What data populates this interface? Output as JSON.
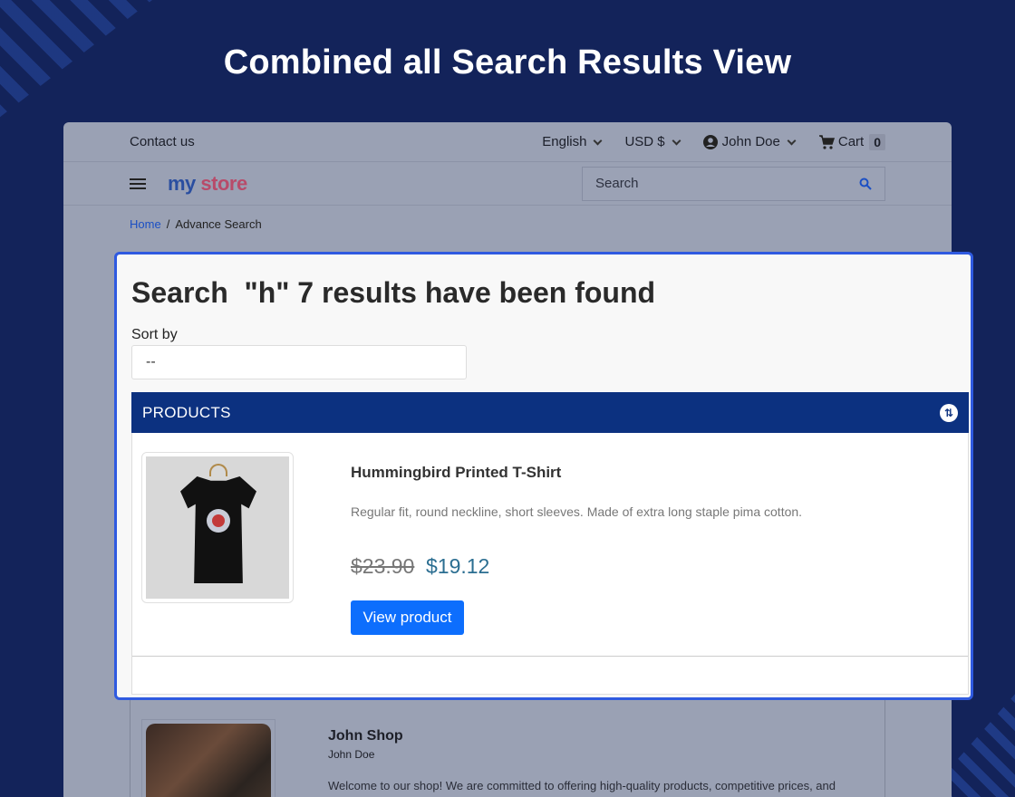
{
  "headline": "Combined all Search Results View",
  "topbar": {
    "contact": "Contact us",
    "language": "English",
    "currency": "USD $",
    "user": "John Doe",
    "cart_label": "Cart",
    "cart_count": "0"
  },
  "navbar": {
    "logo_part1": "my",
    "logo_part2": "store",
    "search_placeholder": "Search"
  },
  "breadcrumb": {
    "home": "Home",
    "separator": "/",
    "current": "Advance Search"
  },
  "results": {
    "heading": "Search  \"h\" 7 results have been found",
    "sort_label": "Sort by",
    "sort_value": "--",
    "section_title": "PRODUCTS"
  },
  "product": {
    "name": "Hummingbird Printed T-Shirt",
    "description": "Regular fit, round neckline, short sleeves. Made of extra long staple pima cotton.",
    "price_old": "$23.90",
    "price_new": "$19.12",
    "button": "View product"
  },
  "shop": {
    "name": "John Shop",
    "owner": "John Doe",
    "description": "Welcome to our shop! We are committed to offering high-quality products, competitive prices, and"
  },
  "colors": {
    "background": "#13235a",
    "highlight_border": "#2f5ae0",
    "products_bar": "#0c3180",
    "primary_button": "#0d6efd",
    "sale_price": "#2b6e91"
  }
}
